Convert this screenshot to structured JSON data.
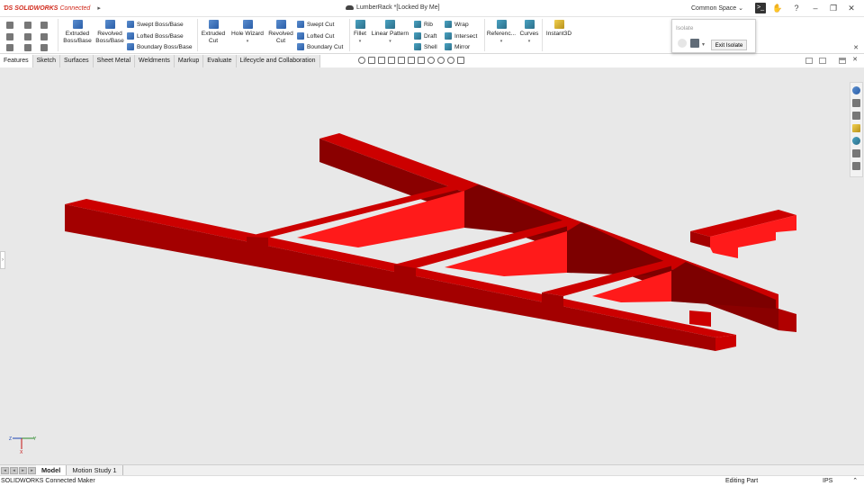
{
  "app": {
    "brand": "SOLIDWORKS",
    "brand_suffix": "Connected",
    "document_title": "LumberRack *[Locked By Me]",
    "space_selector": "Common Space"
  },
  "ribbon": {
    "extruded_boss": "Extruded Boss/Base",
    "revolved_boss": "Revolved Boss/Base",
    "swept_boss": "Swept Boss/Base",
    "lofted_boss": "Lofted Boss/Base",
    "boundary_boss": "Boundary Boss/Base",
    "extruded_cut": "Extruded Cut",
    "hole_wizard": "Hole Wizard",
    "revolved_cut": "Revolved Cut",
    "swept_cut": "Swept Cut",
    "lofted_cut": "Lofted Cut",
    "boundary_cut": "Boundary Cut",
    "fillet": "Fillet",
    "linear_pattern": "Linear Pattern",
    "rib": "Rib",
    "draft": "Draft",
    "shell": "Shell",
    "wrap": "Wrap",
    "intersect": "Intersect",
    "mirror": "Mirror",
    "reference": "Referenc...",
    "curves": "Curves",
    "instant3d": "Instant3D"
  },
  "isolate": {
    "title": "Isolate",
    "exit_label": "Exit Isolate"
  },
  "tabs": [
    "Features",
    "Sketch",
    "Surfaces",
    "Sheet Metal",
    "Weldments",
    "Markup",
    "Evaluate",
    "Lifecycle and Collaboration"
  ],
  "bottom_tabs": [
    "Model",
    "Motion Study 1"
  ],
  "status": {
    "left": "SOLIDWORKS Connected Maker",
    "mode": "Editing Part",
    "units": "IPS"
  },
  "colors": {
    "part_top": "#cc0000",
    "part_side": "#a30000",
    "part_dark": "#7d0000",
    "part_bright": "#ff1a1a",
    "viewport_bg": "#e8e8e8"
  }
}
